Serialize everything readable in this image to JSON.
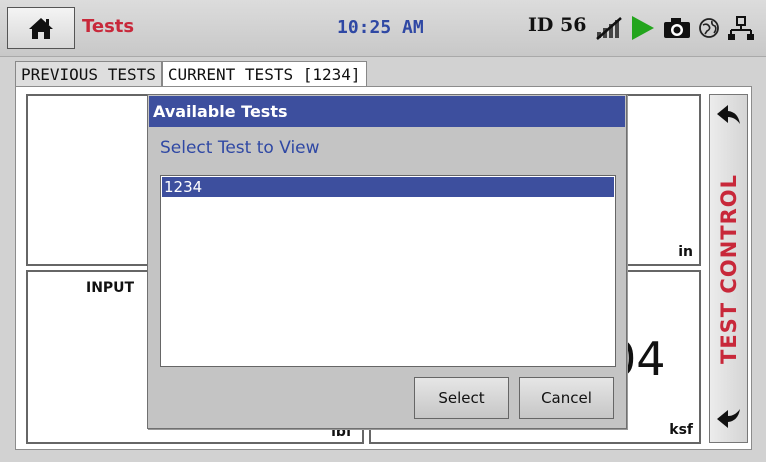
{
  "header": {
    "title": "Tests",
    "time": "10:25 AM",
    "device_id": "ID 56",
    "icons": [
      "home-icon",
      "signal-off-icon",
      "play-icon",
      "camera-icon",
      "globe-icon",
      "network-icon"
    ],
    "colors": {
      "title": "#c8283a",
      "time": "#2f48a4",
      "play": "#23a51d"
    }
  },
  "tabs": [
    {
      "label": "PREVIOUS TESTS"
    },
    {
      "label": "CURRENT TESTS [1234]"
    }
  ],
  "panels": {
    "top_unit": "in",
    "input_label": "INPUT",
    "input_unit": "lbf",
    "value_fragment": "04",
    "value_unit": "ksf"
  },
  "side": {
    "label": "TEST CONTROL",
    "icons": [
      "arrow-up-left-icon",
      "arrow-down-left-icon"
    ]
  },
  "dialog": {
    "title": "Available Tests",
    "prompt": "Select Test to View",
    "items": [
      "1234"
    ],
    "select_label": "Select",
    "cancel_label": "Cancel",
    "colors": {
      "titlebar": "#3d4f9e",
      "selection": "#3d4f9e"
    }
  }
}
